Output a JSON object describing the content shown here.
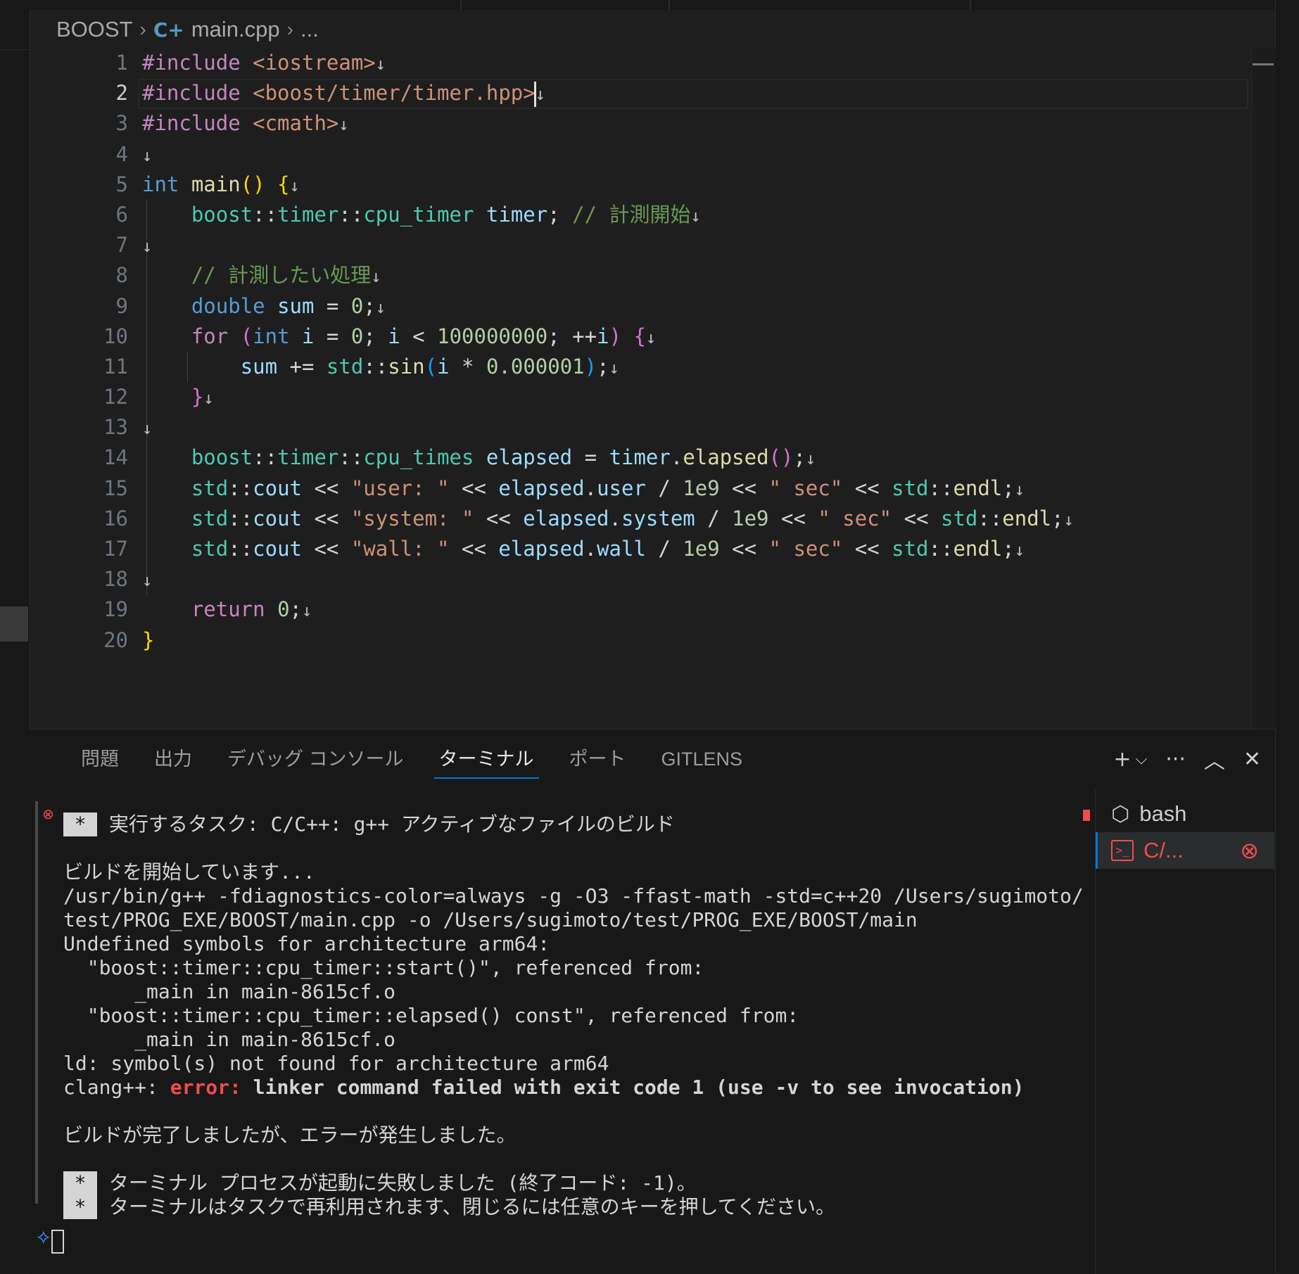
{
  "breadcrumb": {
    "folder": "BOOST",
    "file": "main.cpp",
    "more": "..."
  },
  "editor": {
    "active_line": 2,
    "line_numbers": [
      "1",
      "2",
      "3",
      "4",
      "5",
      "6",
      "7",
      "8",
      "9",
      "10",
      "11",
      "12",
      "13",
      "14",
      "15",
      "16",
      "17",
      "18",
      "19",
      "20"
    ],
    "lines": [
      [
        [
          "pre",
          "#include "
        ],
        [
          "str",
          "<iostream>"
        ],
        [
          "nl",
          "↓"
        ]
      ],
      [
        [
          "pre",
          "#include "
        ],
        [
          "str",
          "<boost/timer/timer.hpp>"
        ],
        [
          "cursor",
          ""
        ],
        [
          "nl",
          "↓"
        ]
      ],
      [
        [
          "pre",
          "#include "
        ],
        [
          "str",
          "<cmath>"
        ],
        [
          "nl",
          "↓"
        ]
      ],
      [
        [
          "nl",
          "↓"
        ]
      ],
      [
        [
          "kw",
          "int "
        ],
        [
          "fn",
          "main"
        ],
        [
          "b1",
          "() {"
        ],
        [
          "nl",
          "↓"
        ]
      ],
      [
        [
          "txt",
          "    "
        ],
        [
          "ty",
          "boost"
        ],
        [
          "txt",
          "::"
        ],
        [
          "ty",
          "timer"
        ],
        [
          "txt",
          "::"
        ],
        [
          "ty",
          "cpu_timer "
        ],
        [
          "var",
          "timer"
        ],
        [
          "txt",
          "; "
        ],
        [
          "cm",
          "// 計測開始"
        ],
        [
          "nl",
          "↓"
        ]
      ],
      [
        [
          "nl",
          "↓"
        ]
      ],
      [
        [
          "txt",
          "    "
        ],
        [
          "cm",
          "// 計測したい処理"
        ],
        [
          "nl",
          "↓"
        ]
      ],
      [
        [
          "txt",
          "    "
        ],
        [
          "kw",
          "double "
        ],
        [
          "var",
          "sum"
        ],
        [
          "txt",
          " = "
        ],
        [
          "num",
          "0"
        ],
        [
          "txt",
          ";"
        ],
        [
          "nl",
          "↓"
        ]
      ],
      [
        [
          "txt",
          "    "
        ],
        [
          "ctl",
          "for "
        ],
        [
          "b2",
          "("
        ],
        [
          "kw",
          "int "
        ],
        [
          "var",
          "i"
        ],
        [
          "txt",
          " = "
        ],
        [
          "num",
          "0"
        ],
        [
          "txt",
          "; "
        ],
        [
          "var",
          "i"
        ],
        [
          "txt",
          " < "
        ],
        [
          "num",
          "100000000"
        ],
        [
          "txt",
          "; ++"
        ],
        [
          "var",
          "i"
        ],
        [
          "b2",
          ") {"
        ],
        [
          "nl",
          "↓"
        ]
      ],
      [
        [
          "txt",
          "        "
        ],
        [
          "var",
          "sum"
        ],
        [
          "txt",
          " += "
        ],
        [
          "ty",
          "std"
        ],
        [
          "txt",
          "::"
        ],
        [
          "fn",
          "sin"
        ],
        [
          "b3",
          "("
        ],
        [
          "var",
          "i"
        ],
        [
          "txt",
          " * "
        ],
        [
          "num",
          "0.000001"
        ],
        [
          "b3",
          ")"
        ],
        [
          "txt",
          ";"
        ],
        [
          "nl",
          "↓"
        ]
      ],
      [
        [
          "txt",
          "    "
        ],
        [
          "b2",
          "}"
        ],
        [
          "nl",
          "↓"
        ]
      ],
      [
        [
          "nl",
          "↓"
        ]
      ],
      [
        [
          "txt",
          "    "
        ],
        [
          "ty",
          "boost"
        ],
        [
          "txt",
          "::"
        ],
        [
          "ty",
          "timer"
        ],
        [
          "txt",
          "::"
        ],
        [
          "ty",
          "cpu_times "
        ],
        [
          "var",
          "elapsed"
        ],
        [
          "txt",
          " = "
        ],
        [
          "var",
          "timer"
        ],
        [
          "txt",
          "."
        ],
        [
          "fn",
          "elapsed"
        ],
        [
          "b2",
          "()"
        ],
        [
          "txt",
          ";"
        ],
        [
          "nl",
          "↓"
        ]
      ],
      [
        [
          "txt",
          "    "
        ],
        [
          "ty",
          "std"
        ],
        [
          "txt",
          "::"
        ],
        [
          "var",
          "cout"
        ],
        [
          "txt",
          " << "
        ],
        [
          "str",
          "\"user: \""
        ],
        [
          "txt",
          " << "
        ],
        [
          "var",
          "elapsed"
        ],
        [
          "txt",
          "."
        ],
        [
          "var",
          "user"
        ],
        [
          "txt",
          " / "
        ],
        [
          "num",
          "1e9"
        ],
        [
          "txt",
          " << "
        ],
        [
          "str",
          "\" sec\""
        ],
        [
          "txt",
          " << "
        ],
        [
          "ty",
          "std"
        ],
        [
          "txt",
          "::"
        ],
        [
          "fn",
          "endl"
        ],
        [
          "txt",
          ";"
        ],
        [
          "nl",
          "↓"
        ]
      ],
      [
        [
          "txt",
          "    "
        ],
        [
          "ty",
          "std"
        ],
        [
          "txt",
          "::"
        ],
        [
          "var",
          "cout"
        ],
        [
          "txt",
          " << "
        ],
        [
          "str",
          "\"system: \""
        ],
        [
          "txt",
          " << "
        ],
        [
          "var",
          "elapsed"
        ],
        [
          "txt",
          "."
        ],
        [
          "var",
          "system"
        ],
        [
          "txt",
          " / "
        ],
        [
          "num",
          "1e9"
        ],
        [
          "txt",
          " << "
        ],
        [
          "str",
          "\" sec\""
        ],
        [
          "txt",
          " << "
        ],
        [
          "ty",
          "std"
        ],
        [
          "txt",
          "::"
        ],
        [
          "fn",
          "endl"
        ],
        [
          "txt",
          ";"
        ],
        [
          "nl",
          "↓"
        ]
      ],
      [
        [
          "txt",
          "    "
        ],
        [
          "ty",
          "std"
        ],
        [
          "txt",
          "::"
        ],
        [
          "var",
          "cout"
        ],
        [
          "txt",
          " << "
        ],
        [
          "str",
          "\"wall: \""
        ],
        [
          "txt",
          " << "
        ],
        [
          "var",
          "elapsed"
        ],
        [
          "txt",
          "."
        ],
        [
          "var",
          "wall"
        ],
        [
          "txt",
          " / "
        ],
        [
          "num",
          "1e9"
        ],
        [
          "txt",
          " << "
        ],
        [
          "str",
          "\" sec\""
        ],
        [
          "txt",
          " << "
        ],
        [
          "ty",
          "std"
        ],
        [
          "txt",
          "::"
        ],
        [
          "fn",
          "endl"
        ],
        [
          "txt",
          ";"
        ],
        [
          "nl",
          "↓"
        ]
      ],
      [
        [
          "nl",
          "↓"
        ]
      ],
      [
        [
          "txt",
          "    "
        ],
        [
          "ctl",
          "return "
        ],
        [
          "num",
          "0"
        ],
        [
          "txt",
          ";"
        ],
        [
          "nl",
          "↓"
        ]
      ],
      [
        [
          "b1",
          "}"
        ]
      ]
    ]
  },
  "panel": {
    "tabs": [
      "問題",
      "出力",
      "デバッグ コンソール",
      "ターミナル",
      "ポート",
      "GITLENS"
    ],
    "active_tab": "ターミナル",
    "actions": {
      "add": "+",
      "dropdown": "⌵",
      "more": "···",
      "maximize": "︿",
      "close": "✕"
    }
  },
  "terminal": {
    "task_line": "実行するタスク: C/C++: g++ アクティブなファイルのビルド",
    "star": "*",
    "build_start": "ビルドを開始しています...",
    "cmd1": "/usr/bin/g++ -fdiagnostics-color=always -g -O3 -ffast-math -std=c++20 /Users/sugimoto/",
    "cmd2": "test/PROG_EXE/BOOST/main.cpp -o /Users/sugimoto/test/PROG_EXE/BOOST/main",
    "undef": "Undefined symbols for architecture arm64:",
    "sym1": "  \"boost::timer::cpu_timer::start()\", referenced from:",
    "ref1": "      _main in main-8615cf.o",
    "sym2": "  \"boost::timer::cpu_timer::elapsed() const\", referenced from:",
    "ref2": "      _main in main-8615cf.o",
    "ld": "ld: symbol(s) not found for architecture arm64",
    "clang_prefix": "clang++: ",
    "clang_error": "error: ",
    "clang_msg": "linker command failed with exit code 1 (use -v to see invocation)",
    "build_done": "ビルドが完了しましたが、エラーが発生しました。",
    "proc_fail": "ターミナル プロセスが起動に失敗しました (終了コード: -1)。",
    "reuse": "ターミナルはタスクで再利用されます、閉じるには任意のキーを押してください。"
  },
  "terminal_list": [
    {
      "name": "bash",
      "icon": "bash-icon"
    },
    {
      "name": "C/...",
      "icon": "terminal-icon",
      "error": true
    }
  ],
  "colors": {
    "accent": "#0078d4",
    "error": "#f14c4c",
    "editor_bg": "#1e1e1e",
    "panel_bg": "#181818"
  }
}
